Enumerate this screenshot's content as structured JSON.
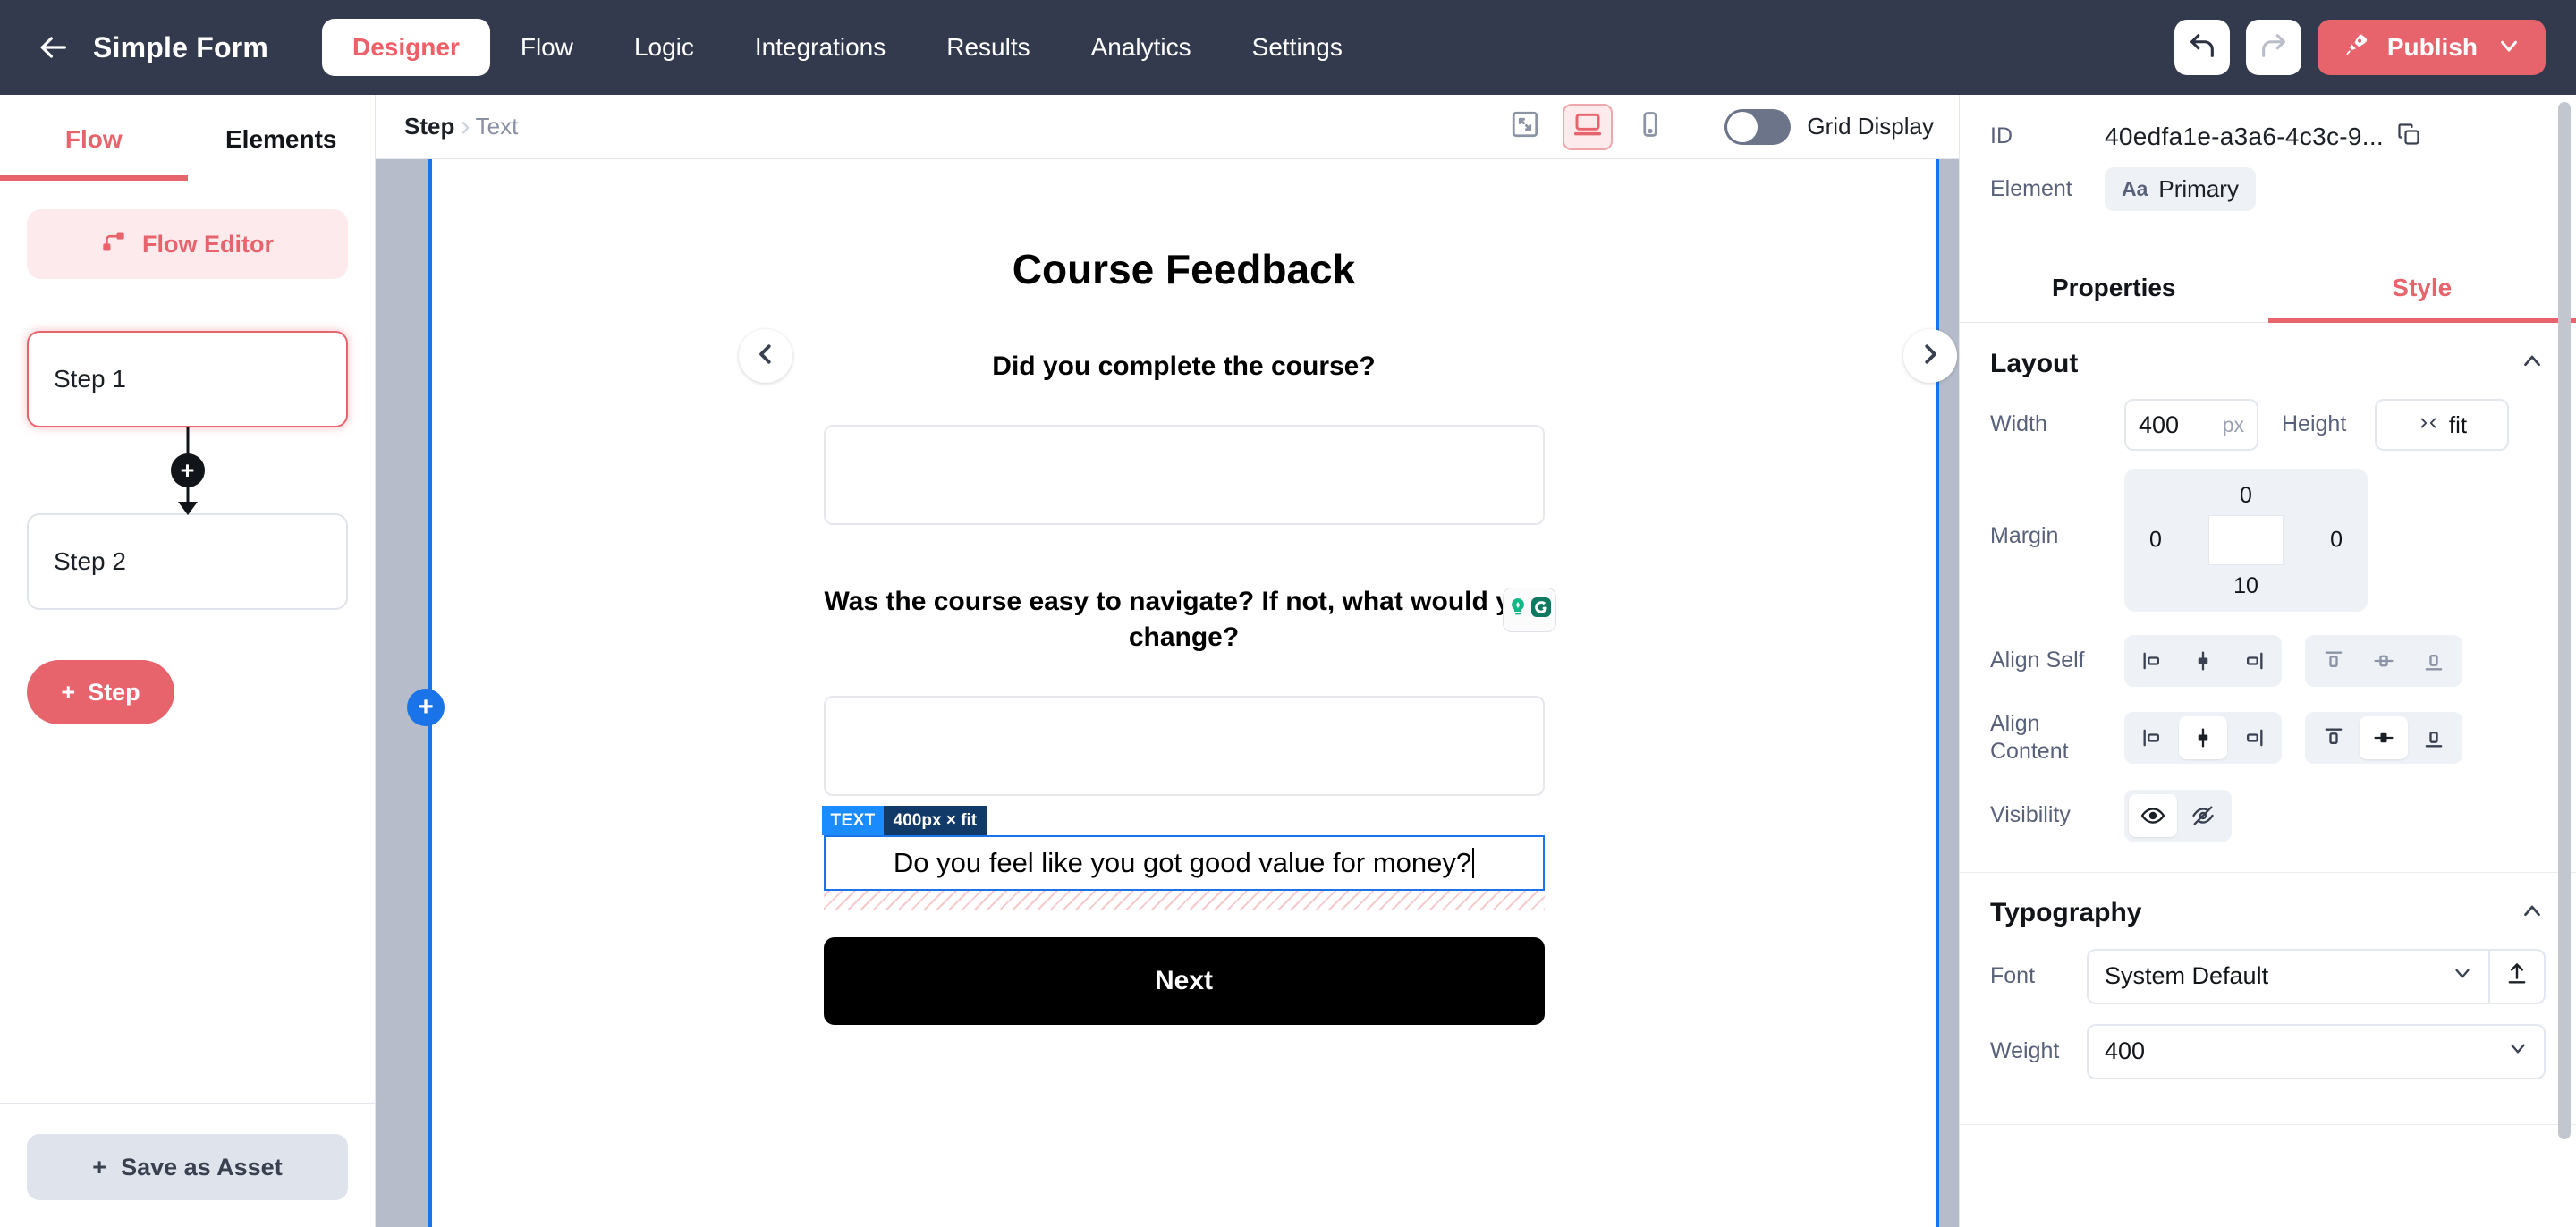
{
  "topnav": {
    "back_icon": "arrow-left-icon",
    "app_title": "Simple Form",
    "tabs": [
      {
        "label": "Designer",
        "active": true
      },
      {
        "label": "Flow",
        "active": false
      },
      {
        "label": "Logic",
        "active": false
      },
      {
        "label": "Integrations",
        "active": false
      },
      {
        "label": "Results",
        "active": false
      },
      {
        "label": "Analytics",
        "active": false
      },
      {
        "label": "Settings",
        "active": false
      }
    ],
    "undo_icon": "undo-icon",
    "redo_icon": "redo-icon",
    "publish_label": "Publish",
    "publish_icon": "rocket-icon",
    "publish_chevron": "chevron-down-icon",
    "publish_color": "#e8646d",
    "bar_color": "#333a4d"
  },
  "left_panel": {
    "tabs": [
      {
        "label": "Flow",
        "active": true
      },
      {
        "label": "Elements",
        "active": false
      }
    ],
    "flow_editor_label": "Flow Editor",
    "flow_editor_icon": "flow-node-icon",
    "steps": [
      {
        "label": "Step 1",
        "selected": true
      },
      {
        "label": "Step 2",
        "selected": false
      }
    ],
    "connector_plus": "+",
    "add_step_label": "Step",
    "add_step_plus": "+",
    "save_asset_label": "Save as Asset",
    "save_asset_plus": "+"
  },
  "canvas_toolbar": {
    "breadcrumb": [
      "Step",
      "Text"
    ],
    "fullscreen_icon": "fullscreen-icon",
    "desktop_icon": "desktop-icon",
    "mobile_icon": "mobile-icon",
    "active_device": "desktop",
    "grid_display_label": "Grid Display",
    "grid_display_on": false
  },
  "canvas": {
    "collapse_left_icon": "chevron-left-icon",
    "collapse_right_icon": "chevron-right-icon",
    "insert_plus": "+",
    "form": {
      "title": "Course Feedback",
      "question_1": "Did you complete the course?",
      "question_2": "Was the course easy to navigate? If not, what would you change?",
      "grammarly_icons": [
        "grammarly-suggestion-icon",
        "grammarly-logo-icon"
      ],
      "selected_element": {
        "badge_tag": "TEXT",
        "badge_size": "400px × fit",
        "text": "Do you feel like you got good value for money?"
      },
      "next_label": "Next"
    }
  },
  "right_panel": {
    "id_label": "ID",
    "id_value": "40edfa1e-a3a6-4c3c-9...",
    "copy_icon": "copy-icon",
    "element_label": "Element",
    "element_chip_icon": "Aa",
    "element_chip_value": "Primary",
    "tabs": [
      {
        "label": "Properties",
        "active": false
      },
      {
        "label": "Style",
        "active": true
      }
    ],
    "layout": {
      "title": "Layout",
      "collapse_icon": "chevron-up-icon",
      "width_label": "Width",
      "width_value": "400",
      "width_unit": "px",
      "height_label": "Height",
      "height_value": "fit",
      "height_icon": "fit-icon",
      "margin_label": "Margin",
      "margin_top": "0",
      "margin_right": "0",
      "margin_bottom": "10",
      "margin_left": "0",
      "align_self_label": "Align Self",
      "align_content_label": "Align Content",
      "visibility_label": "Visibility",
      "align_horizontal_icons": [
        "align-left-icon",
        "align-center-icon",
        "align-right-icon"
      ],
      "align_vertical_icons": [
        "align-top-icon",
        "align-middle-icon",
        "align-bottom-icon"
      ],
      "align_self_selected_h": -1,
      "align_self_selected_v": -1,
      "align_content_selected_h": 1,
      "align_content_selected_v": 1,
      "visibility_icons": [
        "eye-icon",
        "eye-off-icon"
      ],
      "visibility_selected": 0
    },
    "typography": {
      "title": "Typography",
      "collapse_icon": "chevron-up-icon",
      "font_label": "Font",
      "font_value": "System Default",
      "upload_icon": "upload-icon",
      "weight_label": "Weight",
      "weight_value": "400"
    }
  }
}
